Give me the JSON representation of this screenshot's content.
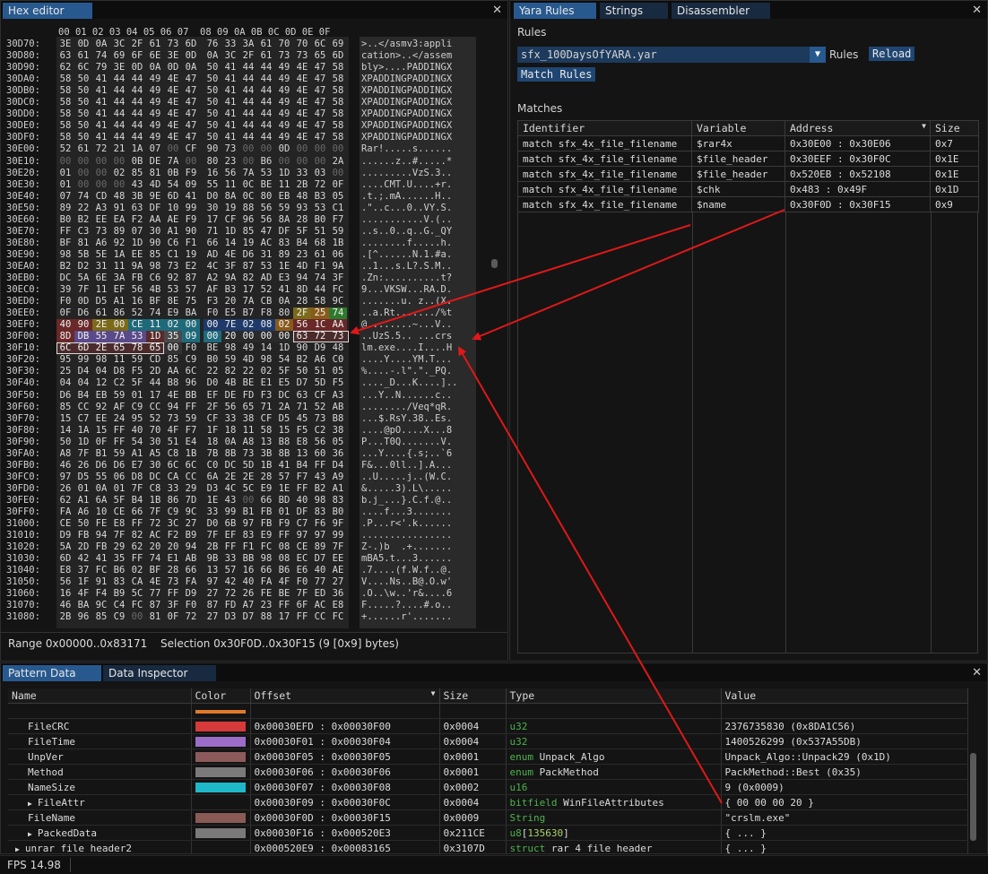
{
  "hex_editor": {
    "tab": "Hex editor",
    "header": "00 01 02 03 04 05 06 07  08 09 0A 0B 0C 0D 0E 0F",
    "rows": [
      {
        "off": "30D70:",
        "bytes": "3E 0D 0A 3C 2F 61 73 6D 76 33 3A 61 70 70 6C 69",
        "ascii": ">..</asmv3:appli"
      },
      {
        "off": "30D80:",
        "bytes": "63 61 74 69 6F 6E 3E 0D 0A 3C 2F 61 73 73 65 6D",
        "ascii": "cation>..</assem"
      },
      {
        "off": "30D90:",
        "bytes": "62 6C 79 3E 0D 0A 0D 0A 50 41 44 44 49 4E 47 58",
        "ascii": "bly>....PADDINGX"
      },
      {
        "off": "30DA0:",
        "bytes": "58 50 41 44 44 49 4E 47 50 41 44 44 49 4E 47 58",
        "ascii": "XPADDINGPADDINGX"
      },
      {
        "off": "30DB0:",
        "bytes": "58 50 41 44 44 49 4E 47 50 41 44 44 49 4E 47 58",
        "ascii": "XPADDINGPADDINGX"
      },
      {
        "off": "30DC0:",
        "bytes": "58 50 41 44 44 49 4E 47 50 41 44 44 49 4E 47 58",
        "ascii": "XPADDINGPADDINGX"
      },
      {
        "off": "30DD0:",
        "bytes": "58 50 41 44 44 49 4E 47 50 41 44 44 49 4E 47 58",
        "ascii": "XPADDINGPADDINGX"
      },
      {
        "off": "30DE0:",
        "bytes": "58 50 41 44 44 49 4E 47 50 41 44 44 49 4E 47 58",
        "ascii": "XPADDINGPADDINGX"
      },
      {
        "off": "30DF0:",
        "bytes": "58 50 41 44 44 49 4E 47 50 41 44 44 49 4E 47 58",
        "ascii": "XPADDINGPADDINGX"
      },
      {
        "off": "30E00:",
        "bytes": "52 61 72 21 1A 07 00 CF 90 73 00 00 0D 00 00 00",
        "ascii": "Rar!.....s......"
      },
      {
        "off": "30E10:",
        "bytes": "00 00 00 00 0B DE 7A 00 80 23 00 B6 00 00 00 2A",
        "ascii": "......z..#.....*"
      },
      {
        "off": "30E20:",
        "bytes": "01 00 00 02 85 81 0B F9 16 56 7A 53 1D 33 03 00",
        "ascii": ".........VzS.3.."
      },
      {
        "off": "30E30:",
        "bytes": "01 00 00 00 43 4D 54 09 55 11 0C BE 11 2B 72 0F",
        "ascii": "....CMT.U....+r."
      },
      {
        "off": "30E40:",
        "bytes": "07 74 CD 48 3B 9E 6D 41 D0 8A 0C 80 EB 48 B3 05",
        "ascii": ".t.;.mA......H.."
      },
      {
        "off": "30E50:",
        "bytes": "89 22 A3 91 63 DF 10 99 30 19 88 56 59 93 53 C1",
        "ascii": ".\"..c...0..VY.S."
      },
      {
        "off": "30E60:",
        "bytes": "B0 B2 EE EA F2 AA AE F9 17 CF 96 56 8A 28 B0 F7",
        "ascii": "...........V.(.."
      },
      {
        "off": "30E70:",
        "bytes": "FF C3 73 89 07 30 A1 90 71 1D 85 47 DF 5F 51 59",
        "ascii": "..s..0..q..G._QY"
      },
      {
        "off": "30E80:",
        "bytes": "BF 81 A6 92 1D 90 C6 F1 66 14 19 AC 83 B4 68 1B",
        "ascii": "........f.....h."
      },
      {
        "off": "30E90:",
        "bytes": "98 5B 5E 1A EE 85 C1 19 AD 4E D6 31 89 23 61 06",
        "ascii": ".[^......N.1.#a."
      },
      {
        "off": "30EA0:",
        "bytes": "B2 D2 31 11 9A 98 73 E2 4C 3F 87 53 1E 4D F1 9A",
        "ascii": "..1...s.L?.S.M.."
      },
      {
        "off": "30EB0:",
        "bytes": "DC 5A 6E 3A FB C6 92 87 A2 9A 82 AD E3 94 74 3F",
        "ascii": ".Zn:..........t?"
      },
      {
        "off": "30EC0:",
        "bytes": "39 7F 11 EF 56 4B 53 57 AF B3 17 52 41 8D 44 FC",
        "ascii": "9...VKSW...RA.D."
      },
      {
        "off": "30ED0:",
        "bytes": "F0 0D D5 A1 16 BF 8E 75 F3 20 7A CB 0A 28 58 9C",
        "ascii": ".......u. z..(X."
      },
      {
        "off": "30EE0:",
        "bytes": "0F D6 61 86 52 74 E9 BA F0 E5 B7 F8 80 2F 25 74",
        "ascii": "..a.Rt......./%t"
      },
      {
        "off": "30EF0:",
        "bytes": "40 90 2E 00 CE 11 02 00 00 7E 02 08 02 56 1C AA",
        "ascii": "@........~...V.."
      },
      {
        "off": "30F00:",
        "bytes": "8D DB 55 7A 53 1D 35 09 00 20 00 00 00 63 72 73",
        "ascii": "..UzS.5.. ...crs"
      },
      {
        "off": "30F10:",
        "bytes": "6C 6D 2E 65 78 65 00 F0 BE 98 49 14 1D 90 D9 48",
        "ascii": "lm.exe....I....H"
      },
      {
        "off": "30F20:",
        "bytes": "95 99 98 11 59 CD 85 C9 B0 59 4D 98 54 B2 A6 C0",
        "ascii": "....Y....YM.T..."
      },
      {
        "off": "30F30:",
        "bytes": "25 D4 04 D8 F5 2D AA 6C 22 82 22 02 5F 50 51 05",
        "ascii": "%....-.l\".\"._PQ."
      },
      {
        "off": "30F40:",
        "bytes": "04 04 12 C2 5F 44 B8 96 D0 4B BE E1 E5 D7 5D F5",
        "ascii": "...._D...K....].."
      },
      {
        "off": "30F50:",
        "bytes": "D6 B4 EB 59 01 17 4E BB EF DE FD F3 DC 63 CF A3",
        "ascii": "...Y..N......c.."
      },
      {
        "off": "30F60:",
        "bytes": "85 CC 92 AF C9 CC 94 FF 2F 56 65 71 2A 71 52 AB",
        "ascii": "......../Veq*qR."
      },
      {
        "off": "30F70:",
        "bytes": "15 C7 EE 24 95 52 73 59 CF 33 38 CF D5 45 73 B8",
        "ascii": "...$.RsY.38..Es."
      },
      {
        "off": "30F80:",
        "bytes": "14 1A 15 FF 40 70 4F F7 1F 18 11 58 15 F5 C2 38",
        "ascii": "....@pO....X...8"
      },
      {
        "off": "30F90:",
        "bytes": "50 1D 0F FF 54 30 51 E4 18 0A A8 13 B8 E8 56 05",
        "ascii": "P...T0Q.......V."
      },
      {
        "off": "30FA0:",
        "bytes": "A8 7F B1 59 A1 A5 C8 1B 7B 8B 73 3B 8B 13 60 36",
        "ascii": "...Y....{.s;..`6"
      },
      {
        "off": "30FB0:",
        "bytes": "46 26 D6 D6 E7 30 6C 6C C0 DC 5D 1B 41 B4 FF D4",
        "ascii": "F&...0ll..].A..."
      },
      {
        "off": "30FC0:",
        "bytes": "97 D5 55 06 D8 DC CA CC 6A 2E 2E 28 57 F7 43 A9",
        "ascii": "..U.....j..(W.C."
      },
      {
        "off": "30FD0:",
        "bytes": "26 01 0A 01 7F C8 33 29 D3 4C 5C E9 1E FF B2 A1",
        "ascii": "&.....3).L\\....."
      },
      {
        "off": "30FE0:",
        "bytes": "62 A1 6A 5F B4 1B 86 7D 1E 43 00 66 BD 40 98 83",
        "ascii": "b.j_...}.C.f.@.."
      },
      {
        "off": "30FF0:",
        "bytes": "FA A6 10 CE 66 7F C9 9C 33 99 B1 FB 01 DF 83 B0",
        "ascii": "....f...3......."
      },
      {
        "off": "31000:",
        "bytes": "CE 50 FE E8 FF 72 3C 27 D0 6B 97 FB F9 C7 F6 9F",
        "ascii": ".P...r<'.k......"
      },
      {
        "off": "31010:",
        "bytes": "D9 FB 94 7F 82 AC F2 B9 7F EF 83 E9 FF 97 97 99",
        "ascii": "................"
      },
      {
        "off": "31020:",
        "bytes": "5A 2D FB 29 62 20 20 94 2B FF F1 FC 08 CE 89 7F",
        "ascii": "Z-.)b  .+......."
      },
      {
        "off": "31030:",
        "bytes": "6D 42 41 35 FF 74 E1 AB 9B 33 BB 98 08 EC D7 EE",
        "ascii": "mBA5.t...3......"
      },
      {
        "off": "31040:",
        "bytes": "E8 37 FC B6 02 BF 28 66 13 57 16 66 B6 E6 40 AE",
        "ascii": ".7....(f.W.f..@."
      },
      {
        "off": "31050:",
        "bytes": "56 1F 91 83 CA 4E 73 FA 97 42 40 FA 4F F0 77 27",
        "ascii": "V....Ns..B@.O.w'"
      },
      {
        "off": "31060:",
        "bytes": "16 4F F4 B9 5C 77 FF D9 27 72 26 FE BE 7F ED 36",
        "ascii": ".O..\\w..'r&....6"
      },
      {
        "off": "31070:",
        "bytes": "46 BA 9C C4 FC 87 3F F0 87 FD A7 23 FF 6F AC E8",
        "ascii": "F.....?....#.o.."
      },
      {
        "off": "31080:",
        "bytes": "2B 96 85 C9 00 81 0F 72 27 D3 D7 88 17 FF CC FC",
        "ascii": "+......r'......."
      }
    ],
    "range_label": "Range 0x00000..0x83171",
    "selection_label": "Selection 0x30F0D..0x30F15 (9 [0x9] bytes)"
  },
  "yara": {
    "tabs": [
      "Yara Rules",
      "Strings",
      "Disassembler"
    ],
    "rules_label": "Rules",
    "rule_file": "sfx_100DaysOfYARA.yar",
    "rules_inline_label": "Rules",
    "reload_label": "Reload",
    "match_rules_label": "Match Rules",
    "matches_label": "Matches",
    "columns": [
      "Identifier",
      "Variable",
      "Address",
      "Size"
    ],
    "rows": [
      {
        "id": "match sfx_4x_file_filename",
        "var": "$rar4x",
        "addr": "0x30E00 : 0x30E06",
        "size": "0x7"
      },
      {
        "id": "match sfx_4x_file_filename",
        "var": "$file_header",
        "addr": "0x30EEF : 0x30F0C",
        "size": "0x1E"
      },
      {
        "id": "match sfx_4x_file_filename",
        "var": "$file_header",
        "addr": "0x520EB : 0x52108",
        "size": "0x1E"
      },
      {
        "id": "match sfx_4x_file_filename",
        "var": "$chk",
        "addr": "0x483 : 0x49F",
        "size": "0x1D"
      },
      {
        "id": "match sfx_4x_file_filename",
        "var": "$name",
        "addr": "0x30F0D : 0x30F15",
        "size": "0x9"
      }
    ]
  },
  "pattern": {
    "tabs": [
      "Pattern Data",
      "Data Inspector"
    ],
    "columns": [
      "Name",
      "Color",
      "Offset",
      "Size",
      "Type",
      "Value"
    ],
    "rows": [
      {
        "name": "FileCRC",
        "color": "#d63a3a",
        "offset": "0x00030EFD : 0x00030F00",
        "size": "0x0004",
        "kw": "",
        "type": "u32",
        "value": "2376735830 (0x8DA1C56)",
        "indent": 1,
        "expand": ""
      },
      {
        "name": "FileTime",
        "color": "#9b6dc8",
        "offset": "0x00030F01 : 0x00030F04",
        "size": "0x0004",
        "kw": "",
        "type": "u32",
        "value": "1400526299 (0x537A55DB)",
        "indent": 1,
        "expand": ""
      },
      {
        "name": "UnpVer",
        "color": "#8c5a5a",
        "offset": "0x00030F05 : 0x00030F05",
        "size": "0x0001",
        "kw": "enum",
        "type": "Unpack_Algo",
        "value": "Unpack_Algo::Unpack29 (0x1D)",
        "indent": 1,
        "expand": ""
      },
      {
        "name": "Method",
        "color": "#7a7a7a",
        "offset": "0x00030F06 : 0x00030F06",
        "size": "0x0001",
        "kw": "enum",
        "type": "PackMethod",
        "value": "PackMethod::Best (0x35)",
        "indent": 1,
        "expand": ""
      },
      {
        "name": "NameSize",
        "color": "#1fb8c8",
        "offset": "0x00030F07 : 0x00030F08",
        "size": "0x0002",
        "kw": "",
        "type": "u16",
        "value": "9 (0x0009)",
        "indent": 1,
        "expand": ""
      },
      {
        "name": "FileAttr",
        "color": "",
        "offset": "0x00030F09 : 0x00030F0C",
        "size": "0x0004",
        "kw": "bitfield",
        "type": "WinFileAttributes",
        "value": "{ 00 00 00 20 }",
        "indent": 1,
        "expand": "▶"
      },
      {
        "name": "FileName",
        "color": "#8a5a55",
        "offset": "0x00030F0D : 0x00030F15",
        "size": "0x0009",
        "kw": "",
        "type": "String",
        "value": "\"crslm.exe\"",
        "indent": 1,
        "expand": ""
      },
      {
        "name": "PackedData",
        "color": "#7a7a7a",
        "offset": "0x00030F16 : 0x000520E3",
        "size": "0x211CE",
        "kw": "",
        "type": "u8[135630]",
        "value": "{ ... }",
        "indent": 1,
        "expand": "▶"
      },
      {
        "name": "unrar_file_header2",
        "color": "",
        "offset": "0x000520E9 : 0x00083165",
        "size": "0x3107D",
        "kw": "struct",
        "type": "rar_4_file_header",
        "value": "{ ... }",
        "indent": 0,
        "expand": "▶"
      }
    ]
  },
  "status": {
    "fps": "FPS 14.98"
  }
}
